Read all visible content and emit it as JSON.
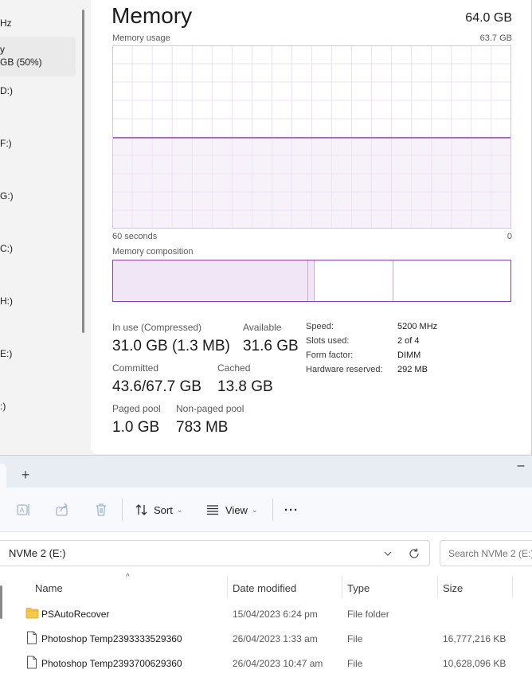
{
  "task_manager": {
    "sidebar": {
      "items": [
        {
          "label": "Hz"
        },
        {
          "line1": "y",
          "line2": "GB (50%)"
        },
        {
          "label": "D:)"
        },
        {
          "label": "F:)"
        },
        {
          "label": "G:)"
        },
        {
          "label": "C:)"
        },
        {
          "label": "H:)"
        },
        {
          "label": "E:)"
        },
        {
          "label": ":)"
        }
      ]
    },
    "title": "Memory",
    "total": "64.0 GB",
    "usage_label": "Memory usage",
    "usage_max": "63.7 GB",
    "axis_left": "60 seconds",
    "axis_right": "0",
    "composition_label": "Memory composition",
    "usage_fraction": 0.496,
    "composition": {
      "in_use_fraction": 0.49,
      "modified_fraction": 0.017,
      "standby_fraction": 0.198
    },
    "stats": {
      "in_use_label": "In use (Compressed)",
      "in_use_value": "31.0 GB (1.3 MB)",
      "available_label": "Available",
      "available_value": "31.6 GB",
      "committed_label": "Committed",
      "committed_value": "43.6/67.7 GB",
      "cached_label": "Cached",
      "cached_value": "13.8 GB",
      "paged_label": "Paged pool",
      "paged_value": "1.0 GB",
      "nonpaged_label": "Non-paged pool",
      "nonpaged_value": "783 MB"
    },
    "specs": [
      {
        "label": "Speed:",
        "value": "5200 MHz"
      },
      {
        "label": "Slots used:",
        "value": "2 of 4"
      },
      {
        "label": "Form factor:",
        "value": "DIMM"
      },
      {
        "label": "Hardware reserved:",
        "value": "292 MB"
      }
    ],
    "colors": {
      "accent": "#8b3fa8",
      "fill": "#f1e6f5",
      "grid": "#e6d8ec"
    }
  },
  "file_explorer": {
    "new_tab": "+",
    "minimize": "–",
    "toolbar": {
      "sort_label": "Sort",
      "view_label": "View",
      "more_label": "···"
    },
    "address": "NVMe 2 (E:)",
    "search_placeholder": "Search NVMe 2 (E:)",
    "columns": {
      "name": "Name",
      "date": "Date modified",
      "type": "Type",
      "size": "Size"
    },
    "rows": [
      {
        "icon": "folder-icon",
        "name": "PSAutoRecover",
        "date": "15/04/2023 6:24 pm",
        "type": "File folder",
        "size": ""
      },
      {
        "icon": "file-icon",
        "name": "Photoshop Temp2393333529360",
        "date": "26/04/2023 1:33 am",
        "type": "File",
        "size": "16,777,216 KB"
      },
      {
        "icon": "file-icon",
        "name": "Photoshop Temp2393700629360",
        "date": "26/04/2023 10:47 am",
        "type": "File",
        "size": "10,628,096 KB"
      }
    ]
  }
}
